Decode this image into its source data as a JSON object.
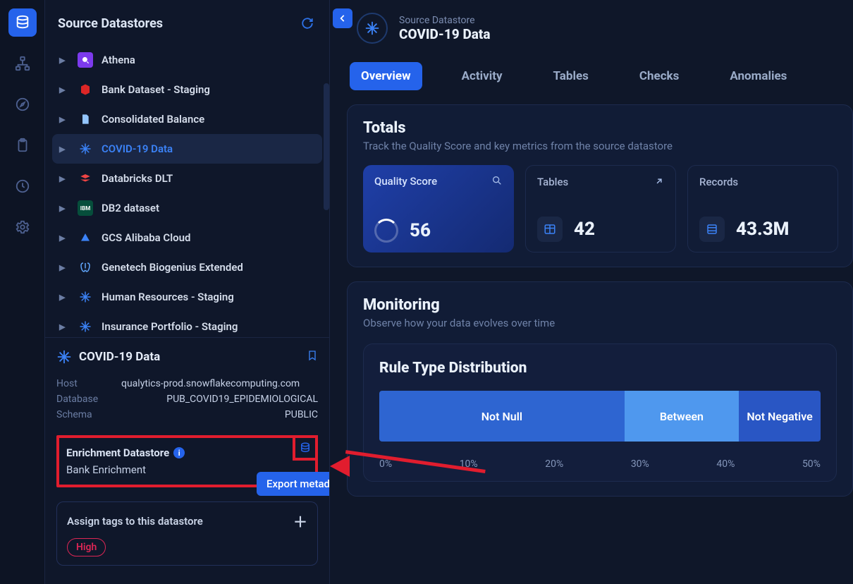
{
  "sidebar": {
    "title": "Source Datastores",
    "items": [
      {
        "label": "Athena"
      },
      {
        "label": "Bank Dataset - Staging"
      },
      {
        "label": "Consolidated Balance"
      },
      {
        "label": "COVID-19 Data"
      },
      {
        "label": "Databricks DLT"
      },
      {
        "label": "DB2 dataset"
      },
      {
        "label": "GCS Alibaba Cloud"
      },
      {
        "label": "Genetech Biogenius Extended"
      },
      {
        "label": "Human Resources - Staging"
      },
      {
        "label": "Insurance Portfolio - Staging"
      }
    ]
  },
  "detail": {
    "title": "COVID-19 Data",
    "host_label": "Host",
    "host": "qualytics-prod.snowflakecomputing.com",
    "db_label": "Database",
    "db": "PUB_COVID19_EPIDEMIOLOGICAL",
    "schema_label": "Schema",
    "schema": "PUBLIC",
    "enrich_title": "Enrichment Datastore",
    "enrich_name": "Bank Enrichment",
    "tooltip": "Export metadata",
    "tags_label": "Assign tags to this datastore",
    "tag1": "High"
  },
  "main": {
    "breadcrumb": "Source Datastore",
    "title": "COVID-19 Data",
    "tabs": {
      "overview": "Overview",
      "activity": "Activity",
      "tables": "Tables",
      "checks": "Checks",
      "anomalies": "Anomalies"
    },
    "totals": {
      "title": "Totals",
      "sub": "Track the Quality Score and key metrics from the source datastore",
      "quality_label": "Quality Score",
      "quality_val": "56",
      "tables_label": "Tables",
      "tables_val": "42",
      "records_label": "Records",
      "records_val": "43.3M"
    },
    "monitor": {
      "title": "Monitoring",
      "sub": "Observe how your data evolves over time"
    }
  },
  "chart_data": {
    "type": "bar",
    "title": "Rule Type Distribution",
    "categories": [
      "Not Null",
      "Between",
      "Not Negative"
    ],
    "values": [
      30,
      14,
      10
    ],
    "colors": [
      "#2e65d1",
      "#4f98ee",
      "#2956c4"
    ],
    "xlabel": "",
    "ylabel": "",
    "xticks": [
      "0%",
      "10%",
      "20%",
      "30%",
      "40%",
      "50%"
    ],
    "ylim": [
      0,
      100
    ]
  }
}
